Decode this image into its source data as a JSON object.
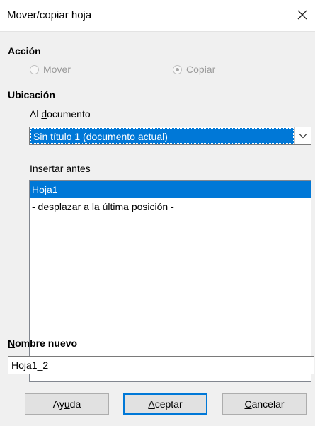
{
  "dialog": {
    "title": "Mover/copiar hoja"
  },
  "action": {
    "heading": "Acción",
    "move_label_first": "M",
    "move_label_rest": "over",
    "copy_label_first": "C",
    "copy_label_rest": "opiar",
    "selected": "Copiar"
  },
  "location": {
    "heading": "Ubicación",
    "to_document_label_pre": "Al ",
    "to_document_label_accel": "d",
    "to_document_label_post": "ocumento",
    "document_value": "Sin título 1 (documento actual)",
    "insert_before_label_accel": "I",
    "insert_before_label_rest": "nsertar antes",
    "sheets": [
      {
        "label": "Hoja1",
        "selected": true
      },
      {
        "label": "- desplazar a la última posición -",
        "selected": false
      }
    ]
  },
  "new_name": {
    "label_accel": "N",
    "label_rest": "ombre nuevo",
    "value": "Hoja1_2"
  },
  "buttons": {
    "help_pre": "Ay",
    "help_accel": "u",
    "help_post": "da",
    "ok_accel": "A",
    "ok_rest": "ceptar",
    "cancel_accel": "C",
    "cancel_rest": "ancelar"
  },
  "colors": {
    "selection": "#0078d7",
    "dialog_bg": "#f0f0f0"
  },
  "icons": {
    "close": "close-icon",
    "dropdown": "chevron-down-icon"
  }
}
